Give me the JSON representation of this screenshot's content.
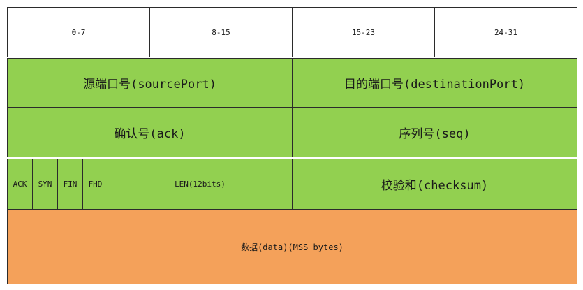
{
  "header": {
    "bits_0_7": "0-7",
    "bits_8_15": "8-15",
    "bits_15_23": "15-23",
    "bits_24_31": "24-31"
  },
  "row1": {
    "source_port": "源端口号(sourcePort)",
    "destination_port": "目的端口号(destinationPort)"
  },
  "row2": {
    "ack": "确认号(ack)",
    "seq": "序列号(seq)"
  },
  "row3": {
    "flag_ack": "ACK",
    "flag_syn": "SYN",
    "flag_fin": "FIN",
    "flag_fhd": "FHD",
    "len": "LEN(12bits)",
    "checksum": "校验和(checksum)"
  },
  "row4": {
    "data": "数据(data)(MSS bytes)"
  },
  "colors": {
    "header_fill": "#ffffff",
    "field_fill": "#92d050",
    "data_fill": "#f4a15a",
    "border": "#2b2b2b"
  }
}
